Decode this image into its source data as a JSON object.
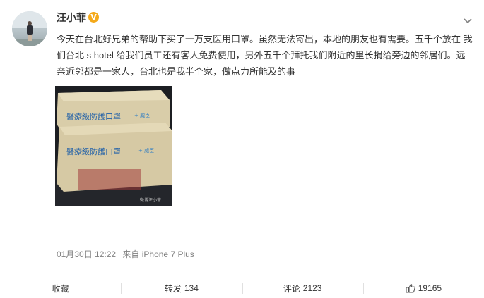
{
  "post": {
    "username": "汪小菲",
    "verified_mark": "V",
    "text": "今天在台北好兄弟的帮助下买了一万支医用口罩。虽然无法寄出，本地的朋友也有需要。五千个放在 我们台北 s hotel 给我们员工还有客人免费使用，另外五千个拜托我们附近的里长捐给旁边的邻居们。远亲近邻都是一家人，台北也是我半个家，做点力所能及的事",
    "image": {
      "box_label": "醫療級防護口罩",
      "box_brand": "+ 威臣",
      "watermark": "微博汪小菲"
    },
    "time": "01月30日 12:22",
    "source": "来自 iPhone 7 Plus"
  },
  "actions": {
    "favorite_label": "收藏",
    "repost_label": "转发",
    "repost_count": "134",
    "comment_label": "评论",
    "comment_count": "2123",
    "like_count": "19165"
  },
  "icons": {
    "dropdown": "chevron-down-icon",
    "like": "thumbs-up-icon",
    "verified": "verified-badge-icon"
  },
  "colors": {
    "verified_badge": "#f4a91a",
    "muted_text": "#808080",
    "box_blue": "#1f5fa8"
  }
}
